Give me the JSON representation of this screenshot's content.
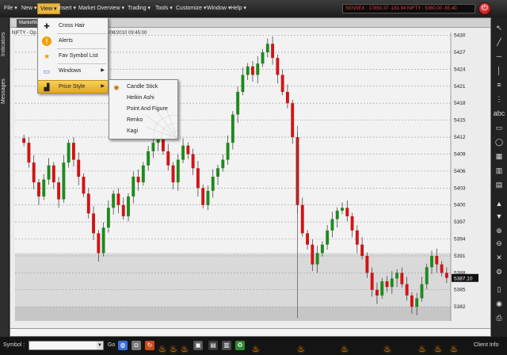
{
  "menubar": {
    "items": [
      {
        "label": "File ▾"
      },
      {
        "label": "New ▾"
      },
      {
        "label": "View ▾"
      },
      {
        "label": "Insert ▾"
      },
      {
        "label": "Market Overview ▾"
      },
      {
        "label": "Trading ▾"
      },
      {
        "label": "Tools ▾"
      },
      {
        "label": "Customize ▾"
      },
      {
        "label": "Window ▾"
      },
      {
        "label": "Help ▾"
      }
    ],
    "ticker": "SENSEX : 17850.37 -181.94   NIFTY : 5360.00 -55.40",
    "power_icon": "power-icon"
  },
  "left_strip": {
    "tabs": [
      {
        "label": "Indicators"
      },
      {
        "label": "Messages"
      }
    ]
  },
  "chart_window": {
    "tab_label": "MarketWatch",
    "info": "NIFTY - Op... 5386.80 Close:5387.10 Date:21/08/2010 09:45:00",
    "current_price_label": "5387.10"
  },
  "view_menu": {
    "items": [
      {
        "label": "Cross Hair",
        "icon": "crosshair-icon"
      },
      {
        "label": "Alerts",
        "icon": "alert-icon"
      },
      {
        "label": "Fav Symbol List",
        "icon": "star-icon"
      },
      {
        "label": "Windows",
        "icon": "windows-icon"
      },
      {
        "label": "Price Style",
        "icon": "chart-style-icon"
      }
    ]
  },
  "price_style_menu": {
    "items": [
      {
        "label": "Candle Stick"
      },
      {
        "label": "Heikin Ashi"
      },
      {
        "label": "Point And Figure"
      },
      {
        "label": "Renko"
      },
      {
        "label": "Kagi"
      }
    ]
  },
  "statusbar": {
    "symbol_label": "Symbol :",
    "symbol_value": "",
    "go_label": "Go",
    "client_info": "Client Info"
  },
  "chart_data": {
    "type": "candlestick",
    "y_ticks": [
      5430,
      5427,
      5424,
      5421,
      5418,
      5415,
      5412,
      5409,
      5406,
      5403,
      5400,
      5397,
      5394,
      5391,
      5388,
      5385,
      5382
    ],
    "ylim": [
      5379.5,
      5430.5
    ],
    "up_color": "#1e8a1e",
    "down_color": "#d01414",
    "closes": [
      5411.0,
      5407.5,
      5404.0,
      5401.5,
      5404.5,
      5407.0,
      5404.0,
      5401.0,
      5407.5,
      5411.0,
      5408.0,
      5405.0,
      5402.0,
      5398.5,
      5395.0,
      5391.5,
      5396.0,
      5399.5,
      5402.0,
      5400.0,
      5398.0,
      5401.5,
      5405.0,
      5404.0,
      5407.0,
      5409.5,
      5411.0,
      5413.0,
      5409.5,
      5407.0,
      5404.0,
      5408.0,
      5410.5,
      5409.0,
      5406.5,
      5403.0,
      5400.0,
      5402.5,
      5405.0,
      5406.5,
      5408.0,
      5411.0,
      5416.0,
      5420.0,
      5423.0,
      5424.5,
      5423.0,
      5425.0,
      5427.0,
      5428.5,
      5426.0,
      5423.0,
      5420.0,
      5418.0,
      5412.0,
      5400.0,
      5395.0,
      5393.0,
      5389.5,
      5391.5,
      5393.0,
      5395.5,
      5397.5,
      5399.0,
      5399.5,
      5398.0,
      5395.5,
      5393.0,
      5391.0,
      5388.0,
      5385.0,
      5384.0,
      5386.5,
      5385.5,
      5387.0,
      5388.0,
      5386.0,
      5384.0,
      5382.0,
      5383.5,
      5386.0,
      5389.0,
      5391.0,
      5389.5,
      5388.0,
      5387.1
    ]
  }
}
